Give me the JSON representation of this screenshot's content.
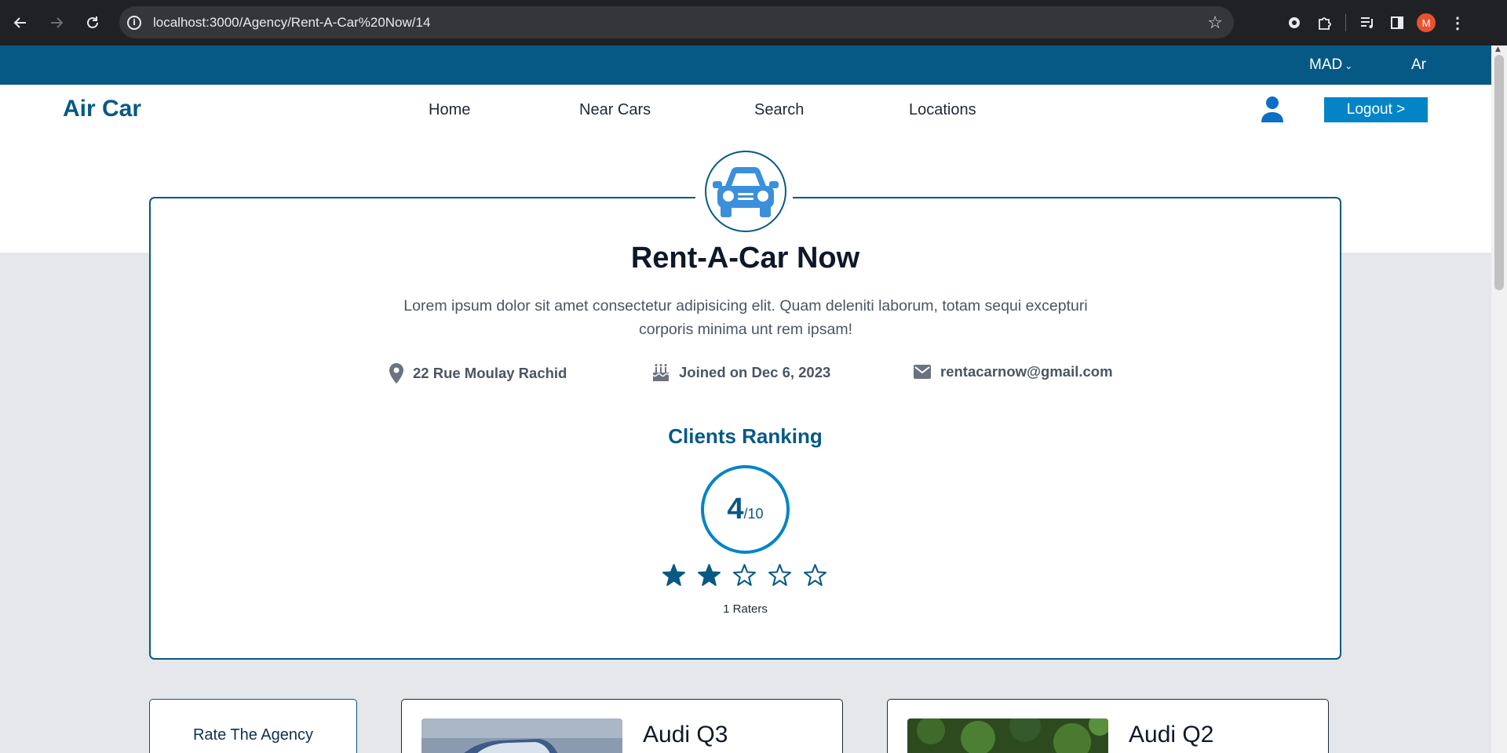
{
  "browser": {
    "url": "localhost:3000/Agency/Rent-A-Car%20Now/14",
    "profile_initial": "M"
  },
  "topbar": {
    "currency": "MAD",
    "language": "Ar"
  },
  "header": {
    "brand": "Air Car",
    "nav": [
      "Home",
      "Near Cars",
      "Search",
      "Locations"
    ],
    "logout_label": "Logout >"
  },
  "agency": {
    "name": "Rent-A-Car Now",
    "description": "Lorem ipsum dolor sit amet consectetur adipisicing elit. Quam deleniti laborum, totam sequi excepturi corporis minima unt rem ipsam!",
    "address": "22 Rue Moulay Rachid",
    "joined": "Joined on Dec 6, 2023",
    "email": "rentacarnow@gmail.com"
  },
  "ranking": {
    "title": "Clients Ranking",
    "score": "4",
    "max": "/10",
    "stars_filled": 2,
    "stars_total": 5,
    "raters": "1 Raters"
  },
  "rate_card": {
    "label": "Rate The Agency"
  },
  "cars": [
    {
      "title": "Audi Q3"
    },
    {
      "title": "Audi Q2"
    }
  ],
  "colors": {
    "brand": "#075985",
    "accent": "#0284c7",
    "icon_blue": "#3b8fdc"
  }
}
